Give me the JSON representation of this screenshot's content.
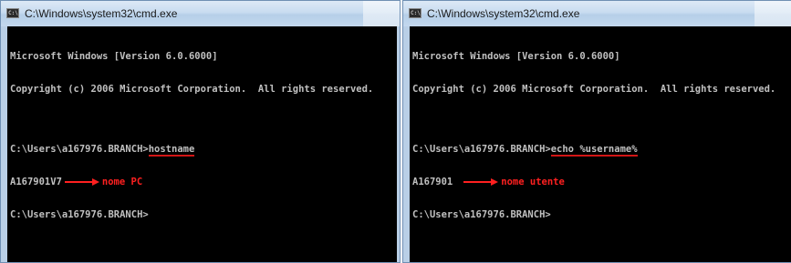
{
  "windows": [
    {
      "title": "C:\\Windows\\system32\\cmd.exe",
      "lines": {
        "version": "Microsoft Windows [Version 6.0.6000]",
        "copyright": "Copyright (c) 2006 Microsoft Corporation.  All rights reserved.",
        "prompt1": "C:\\Users\\a167976.BRANCH>",
        "command": "hostname",
        "output": "A167901V7",
        "annotation": "nome PC",
        "prompt2": "C:\\Users\\a167976.BRANCH>"
      }
    },
    {
      "title": "C:\\Windows\\system32\\cmd.exe",
      "lines": {
        "version": "Microsoft Windows [Version 6.0.6000]",
        "copyright": "Copyright (c) 2006 Microsoft Corporation.  All rights reserved.",
        "prompt1": "C:\\Users\\a167976.BRANCH>",
        "command": "echo %username%",
        "output": "A167901",
        "annotation": "nome utente",
        "prompt2": "C:\\Users\\a167976.BRANCH>"
      }
    }
  ],
  "icons": {
    "app": "cmd-icon",
    "annotation": "red-arrow-icon"
  },
  "colors": {
    "annotation": "#ff2020",
    "console_bg": "#000000",
    "console_text": "#c0c0c0"
  }
}
